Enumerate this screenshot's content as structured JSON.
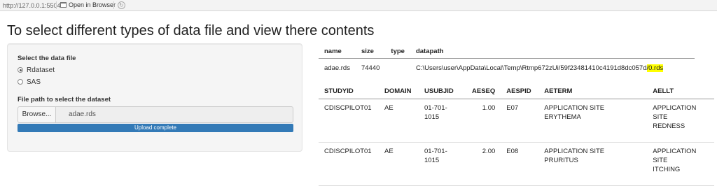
{
  "viewer": {
    "url": "http://127.0.0.1:5504",
    "open_in_browser": "Open in Browser"
  },
  "page": {
    "title": "To select different types of data file and view there contents"
  },
  "sidebar": {
    "select_label": "Select the data file",
    "options": [
      "Rdataset",
      "SAS"
    ],
    "selected_option": "Rdataset",
    "file_path_label": "File path to select the dataset",
    "browse_label": "Browse...",
    "file_name": "adae.rds",
    "upload_status": "Upload complete",
    "upload_progress_percent": 100
  },
  "file_info": {
    "headers": [
      "name",
      "size",
      "type",
      "datapath"
    ],
    "row": {
      "name": "adae.rds",
      "size": "74440",
      "type": "",
      "datapath_prefix": "C:\\Users\\user\\AppData\\Local\\Temp\\Rtmp672zUi/59f23481410c4191d8dc057d",
      "datapath_highlight": "/0.rds"
    },
    "highlight_color": "#ffff00"
  },
  "data_table": {
    "headers": [
      "STUDYID",
      "DOMAIN",
      "USUBJID",
      "AESEQ",
      "AESPID",
      "AETERM",
      "AELLT"
    ],
    "rows": [
      {
        "STUDYID": "CDISCPILOT01",
        "DOMAIN": "AE",
        "USUBJID_1": "01-701-",
        "USUBJID_2": "1015",
        "AESEQ": "1.00",
        "AESPID": "E07",
        "AETERM_1": "APPLICATION SITE",
        "AETERM_2": "ERYTHEMA",
        "AELLT_1": "APPLICATION SITE",
        "AELLT_2": "REDNESS"
      },
      {
        "STUDYID": "CDISCPILOT01",
        "DOMAIN": "AE",
        "USUBJID_1": "01-701-",
        "USUBJID_2": "1015",
        "AESEQ": "2.00",
        "AESPID": "E08",
        "AETERM_1": "APPLICATION SITE",
        "AETERM_2": "PRURITUS",
        "AELLT_1": "APPLICATION SITE",
        "AELLT_2": "ITCHING"
      }
    ]
  },
  "colors": {
    "accent": "#337ab7",
    "well_bg": "#f5f5f5"
  }
}
